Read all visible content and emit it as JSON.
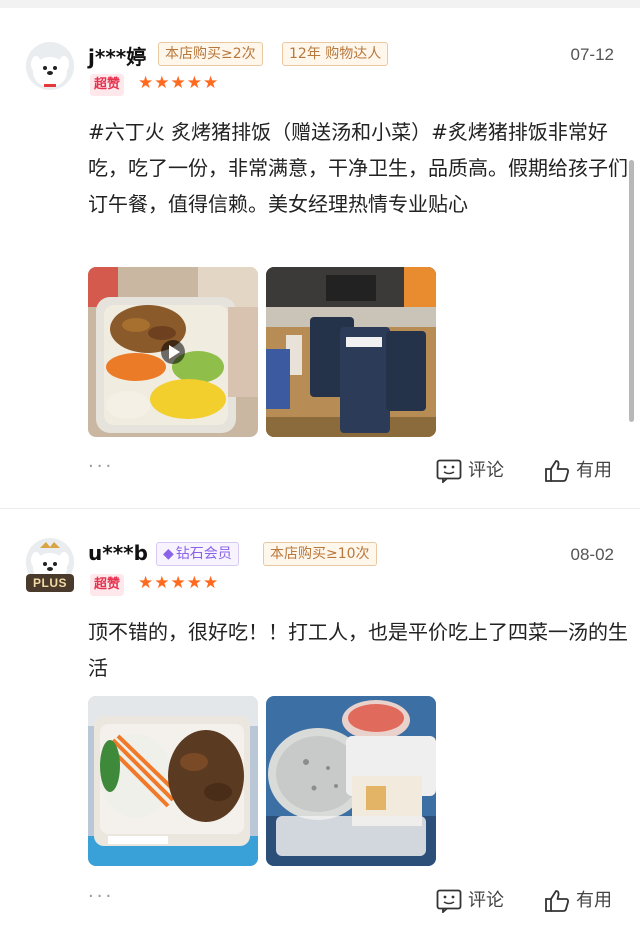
{
  "reviews": [
    {
      "username": "j***婷",
      "tags": [
        "本店购买≥2次",
        "12年 购物达人"
      ],
      "date": "07-12",
      "badge": "超赞",
      "stars": "★★★★★",
      "text": "#六丁火 炙烤猪排饭（赠送汤和小菜）#炙烤猪排饭非常好吃，吃了一份，非常满意，干净卫生，品质高。假期给孩子们订午餐，值得信赖。美女经理热情专业贴心",
      "more": "···",
      "comment_label": "评论",
      "like_label": "有用"
    },
    {
      "username": "u***b",
      "plus": "PLUS",
      "member_tag": "钻石会员",
      "member_icon": "diamond-icon",
      "tags": [
        "本店购买≥10次"
      ],
      "date": "08-02",
      "badge": "超赞",
      "stars": "★★★★★",
      "text": "顶不错的，很好吃！！打工人，也是平价吃上了四菜一汤的生活",
      "more": "···",
      "comment_label": "评论",
      "like_label": "有用"
    }
  ],
  "colors": {
    "star": "#ff6a1f",
    "badge_bg": "#ffe8ec",
    "badge_text": "#e5334f",
    "tag_border": "#e9c9a0",
    "tag_text": "#b9783b",
    "diamond": "#8a63e8"
  }
}
